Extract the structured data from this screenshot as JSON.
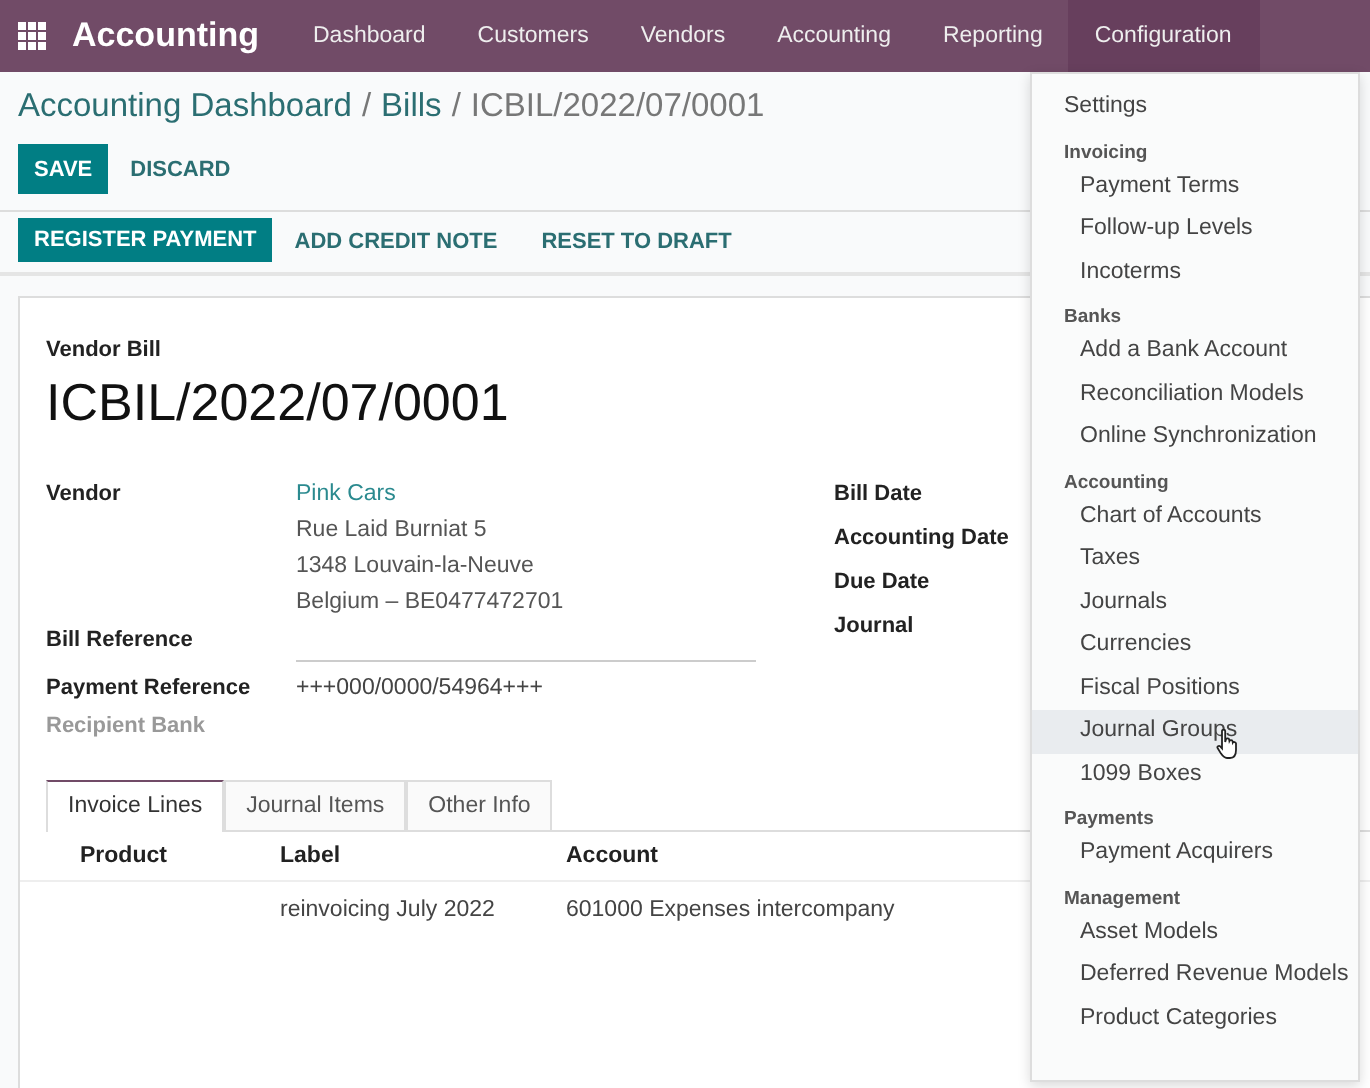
{
  "navbar": {
    "app": "Accounting",
    "menus": [
      {
        "label": "Dashboard",
        "selected": false
      },
      {
        "label": "Customers",
        "selected": false
      },
      {
        "label": "Vendors",
        "selected": false
      },
      {
        "label": "Accounting",
        "selected": false
      },
      {
        "label": "Reporting",
        "selected": false
      },
      {
        "label": "Configuration",
        "selected": true
      }
    ]
  },
  "breadcrumb": [
    {
      "kind": "link",
      "label": "Accounting Dashboard"
    },
    {
      "kind": "separator",
      "label": "/"
    },
    {
      "kind": "link",
      "label": "Bills"
    },
    {
      "kind": "separator",
      "label": "/"
    },
    {
      "kind": "current",
      "label": "ICBIL/2022/07/0001"
    }
  ],
  "actions": [
    "SAVE",
    "DISCARD"
  ],
  "status_actions": [
    "REGISTER PAYMENT",
    "ADD CREDIT NOTE",
    "RESET TO DRAFT"
  ],
  "form": {
    "type": "Vendor Bill",
    "number": "ICBIL/2022/07/0001",
    "left_fields": [
      {
        "label": "Vendor",
        "kind": "partner",
        "value": "Pink Cars",
        "address": [
          "Rue Laid Burniat 5",
          "1348 Louvain-la-Neuve",
          "Belgium – BE0477472701"
        ]
      },
      {
        "label": "Bill Reference",
        "kind": "input"
      },
      {
        "label": "Payment Reference",
        "kind": "text",
        "value": "+++000/0000/54964+++"
      },
      {
        "label": "Recipient Bank",
        "kind": "muted"
      }
    ],
    "right_fields": [
      "Bill Date",
      "Accounting Date",
      "Due Date",
      "Journal"
    ]
  },
  "tabs": [
    {
      "label": "Invoice Lines",
      "selected": true
    },
    {
      "label": "Journal Items",
      "selected": false
    },
    {
      "label": "Other Info",
      "selected": false
    }
  ],
  "table": {
    "columns": [
      "Product",
      "Label",
      "Account"
    ],
    "rows": [
      [
        "",
        "reinvoicing July 2022",
        "601000 Expenses intercompany"
      ]
    ]
  },
  "dropdown": {
    "items": [
      {
        "kind": "item",
        "label": "Settings",
        "selected": false,
        "indent": false
      },
      {
        "kind": "header",
        "label": "Invoicing"
      },
      {
        "kind": "item",
        "label": "Payment Terms",
        "selected": false,
        "indent": true
      },
      {
        "kind": "item",
        "label": "Follow-up Levels",
        "selected": false,
        "indent": true
      },
      {
        "kind": "item",
        "label": "Incoterms",
        "selected": false,
        "indent": true
      },
      {
        "kind": "header",
        "label": "Banks"
      },
      {
        "kind": "item",
        "label": "Add a Bank Account",
        "selected": false,
        "indent": true
      },
      {
        "kind": "item",
        "label": "Reconciliation Models",
        "selected": false,
        "indent": true
      },
      {
        "kind": "item",
        "label": "Online Synchronization",
        "selected": false,
        "indent": true
      },
      {
        "kind": "header",
        "label": "Accounting"
      },
      {
        "kind": "item",
        "label": "Chart of Accounts",
        "selected": false,
        "indent": true
      },
      {
        "kind": "item",
        "label": "Taxes",
        "selected": false,
        "indent": true
      },
      {
        "kind": "item",
        "label": "Journals",
        "selected": false,
        "indent": true
      },
      {
        "kind": "item",
        "label": "Currencies",
        "selected": false,
        "indent": true
      },
      {
        "kind": "item",
        "label": "Fiscal Positions",
        "selected": false,
        "indent": true
      },
      {
        "kind": "item",
        "label": "Journal Groups",
        "selected": true,
        "indent": true
      },
      {
        "kind": "item",
        "label": "1099 Boxes",
        "selected": false,
        "indent": true
      },
      {
        "kind": "header",
        "label": "Payments"
      },
      {
        "kind": "item",
        "label": "Payment Acquirers",
        "selected": false,
        "indent": true
      },
      {
        "kind": "header",
        "label": "Management"
      },
      {
        "kind": "item",
        "label": "Asset Models",
        "selected": false,
        "indent": true
      },
      {
        "kind": "item",
        "label": "Deferred Revenue Models",
        "selected": false,
        "indent": true
      },
      {
        "kind": "item",
        "label": "Product Categories",
        "selected": false,
        "indent": true
      }
    ]
  }
}
